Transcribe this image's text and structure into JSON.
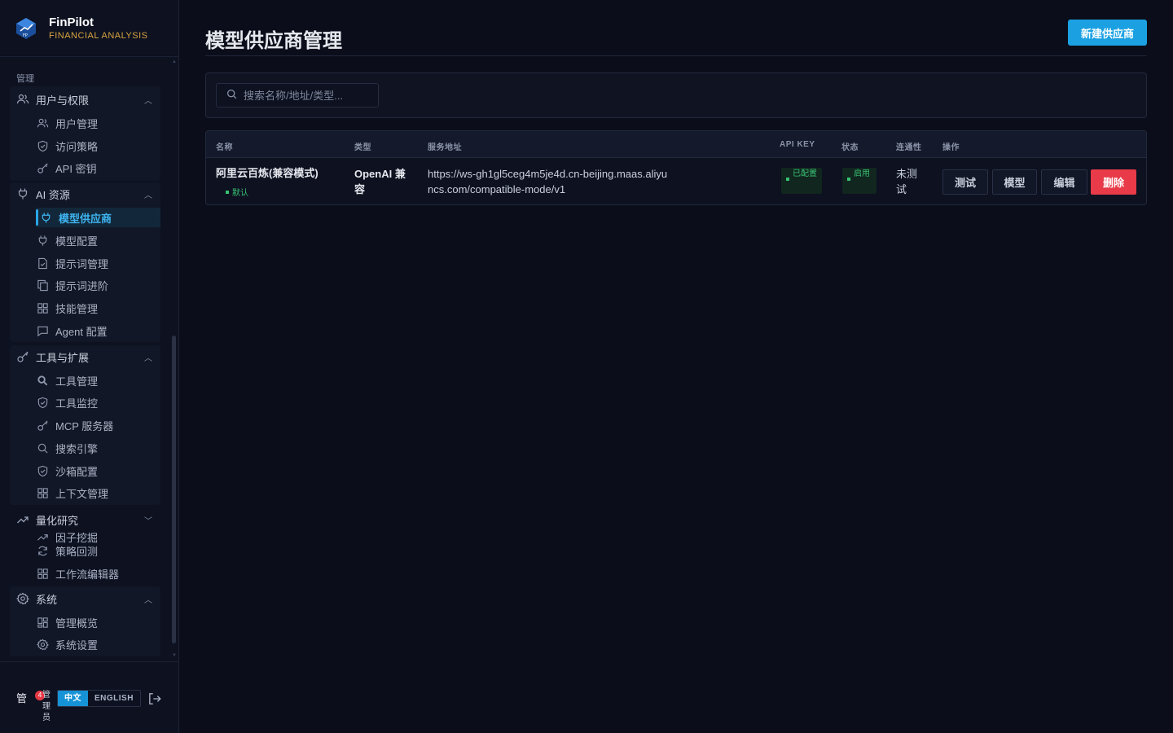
{
  "brand": {
    "name": "FinPilot",
    "subtitle": "FINANCIAL ANALYSIS"
  },
  "nav": {
    "section_label": "管理",
    "groups": [
      {
        "label": "用户与权限",
        "icon": "users-icon",
        "expanded": true,
        "items": [
          {
            "label": "用户管理",
            "icon": "users-icon"
          },
          {
            "label": "访问策略",
            "icon": "shield-icon"
          },
          {
            "label": "API 密钥",
            "icon": "key-icon"
          }
        ]
      },
      {
        "label": "AI 资源",
        "icon": "plug-icon",
        "expanded": true,
        "items": [
          {
            "label": "模型供应商",
            "icon": "plug-icon",
            "active": true
          },
          {
            "label": "模型配置",
            "icon": "plug-icon"
          },
          {
            "label": "提示词管理",
            "icon": "file-check-icon"
          },
          {
            "label": "提示词进阶",
            "icon": "copy-icon"
          },
          {
            "label": "技能管理",
            "icon": "grid-icon"
          },
          {
            "label": "Agent 配置",
            "icon": "message-icon"
          }
        ]
      },
      {
        "label": "工具与扩展",
        "icon": "key-icon",
        "expanded": true,
        "items": [
          {
            "label": "工具管理",
            "icon": "search-bold-icon"
          },
          {
            "label": "工具监控",
            "icon": "shield-icon"
          },
          {
            "label": "MCP 服务器",
            "icon": "key-icon"
          },
          {
            "label": "搜索引擎",
            "icon": "search-icon"
          },
          {
            "label": "沙箱配置",
            "icon": "shield-icon"
          },
          {
            "label": "上下文管理",
            "icon": "grid-icon"
          }
        ]
      },
      {
        "label": "量化研究",
        "icon": "trend-icon",
        "expanded": false,
        "items": [
          {
            "label": "因子挖掘",
            "icon": "trend-icon"
          },
          {
            "label": "策略回测",
            "icon": "refresh-icon"
          },
          {
            "label": "工作流编辑器",
            "icon": "grid-icon"
          }
        ]
      },
      {
        "label": "系统",
        "icon": "gear-icon",
        "expanded": true,
        "items": [
          {
            "label": "管理概览",
            "icon": "dashboard-icon"
          },
          {
            "label": "系统设置",
            "icon": "gear-icon"
          }
        ]
      }
    ]
  },
  "footer": {
    "avatar_text": "管",
    "badge_count": "4",
    "role": "管理员",
    "lang_zh": "中文",
    "lang_en": "ENGLISH"
  },
  "page": {
    "title": "模型供应商管理",
    "new_button": "新建供应商",
    "search_placeholder": "搜索名称/地址/类型..."
  },
  "table": {
    "headers": {
      "name": "名称",
      "type": "类型",
      "url": "服务地址",
      "apikey": "API KEY",
      "status": "状态",
      "connectivity": "连通性",
      "actions": "操作"
    },
    "rows": [
      {
        "name": "阿里云百炼(兼容模式)",
        "default_tag": "默认",
        "type": "OpenAI 兼容",
        "url": "https://ws-gh1gl5ceg4m5je4d.cn-beijing.maas.aliyuncs.com/compatible-mode/v1",
        "apikey": "已配置",
        "status": "启用",
        "connectivity": "未测试",
        "actions": {
          "test": "测试",
          "models": "模型",
          "edit": "编辑",
          "delete": "删除"
        }
      }
    ]
  },
  "colors": {
    "accent": "#1ba1e2",
    "danger": "#e83a48",
    "success": "#38c172",
    "brand_sub": "#d9a441"
  }
}
